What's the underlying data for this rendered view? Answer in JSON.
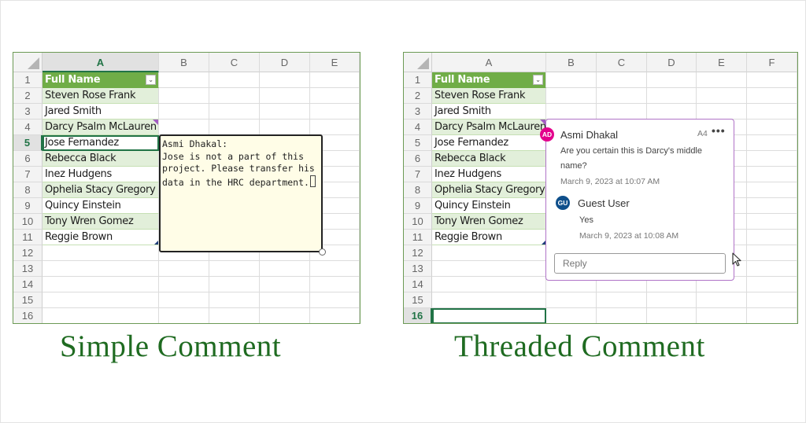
{
  "columns_left": [
    "A",
    "B",
    "C",
    "D",
    "E"
  ],
  "columns_right": [
    "A",
    "B",
    "C",
    "D",
    "E",
    "F"
  ],
  "rows": [
    "1",
    "2",
    "3",
    "4",
    "5",
    "6",
    "7",
    "8",
    "9",
    "10",
    "11",
    "12",
    "13",
    "14",
    "15",
    "16"
  ],
  "table": {
    "header": "Full Name",
    "filter_icon": "chevron-down",
    "names": [
      "Steven Rose Frank",
      "Jared  Smith",
      "Darcy Psalm McLauren",
      "Jose  Fernandez",
      "Rebecca  Black",
      "Inez  Hudgens",
      "Ophelia Stacy Gregory",
      "Quincy  Einstein",
      "Tony Wren Gomez",
      "Reggie  Brown"
    ]
  },
  "simple_comment": {
    "author": "Asmi Dhakal:",
    "lines": [
      "Jose is not a part of this",
      "project. Please transfer his",
      "data in the HRC department."
    ],
    "cell": "A5"
  },
  "threaded_comment": {
    "cell_ref": "A4",
    "more_icon": "•••",
    "first": {
      "initials": "AD",
      "author": "Asmi Dhakal",
      "body_lines": [
        "Are you certain this is Darcy's middle",
        "name?"
      ],
      "date": "March 9, 2023 at 10:07 AM",
      "avatar_color": "#e3008c"
    },
    "reply": {
      "initials": "GU",
      "author": "Guest User",
      "body": "Yes",
      "date": "March 9, 2023 at 10:08 AM",
      "avatar_color": "#0e4f8b"
    },
    "reply_placeholder": "Reply"
  },
  "captions": {
    "left": "Simple Comment",
    "right": "Threaded Comment"
  },
  "colors": {
    "header_green": "#70ad47",
    "band_green": "#e2efda",
    "caption_green": "#1f6b21",
    "note_bg": "#fffde7",
    "thread_border": "#b073c7"
  }
}
